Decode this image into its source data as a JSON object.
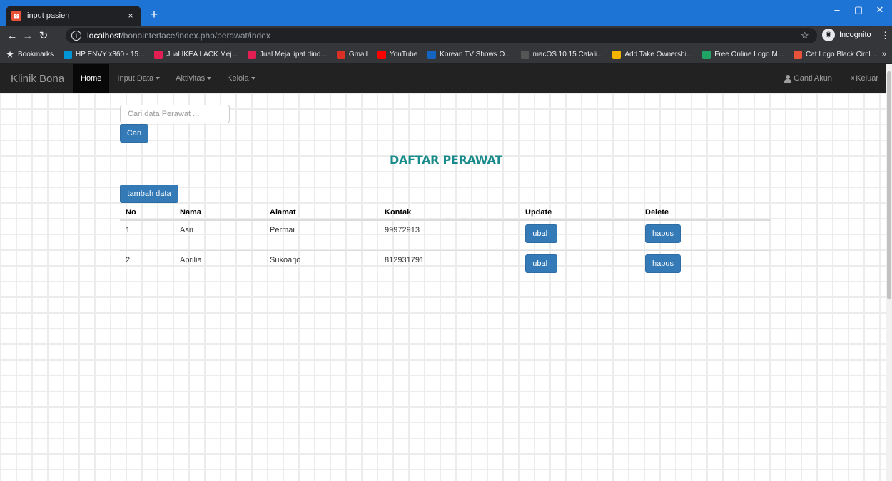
{
  "browser": {
    "tab_title": "input pasien",
    "tab_close": "×",
    "new_tab": "+",
    "win_min": "–",
    "win_max": "▢",
    "win_close": "✕",
    "url_host": "localhost",
    "url_path": "/bonainterface/index.php/perawat/index",
    "incognito_label": "Incognito",
    "bookmarks": [
      {
        "label": "Bookmarks",
        "color": "#35363a"
      },
      {
        "label": "HP ENVY x360 - 15...",
        "color": "#0096d6"
      },
      {
        "label": "Jual IKEA LACK Mej...",
        "color": "#e31e52"
      },
      {
        "label": "Jual Meja lipat dind...",
        "color": "#e31e52"
      },
      {
        "label": "Gmail",
        "color": "#d93025"
      },
      {
        "label": "YouTube",
        "color": "#ff0000"
      },
      {
        "label": "Korean TV Shows O...",
        "color": "#1565c0"
      },
      {
        "label": "macOS 10.15 Catali...",
        "color": "#555555"
      },
      {
        "label": "Add Take Ownershi...",
        "color": "#f4b400"
      },
      {
        "label": "Free Online Logo M...",
        "color": "#1fa463"
      },
      {
        "label": "Cat Logo Black Circl...",
        "color": "#e8513a"
      }
    ]
  },
  "navbar": {
    "brand": "Klinik Bona",
    "home": "Home",
    "input_data": "Input Data",
    "aktivitas": "Aktivitas",
    "kelola": "Kelola",
    "ganti_akun": "Ganti Akun",
    "keluar": "Keluar"
  },
  "search": {
    "placeholder": "Cari data Perawat ...",
    "button": "Cari"
  },
  "page": {
    "title": "DAFTAR PERAWAT",
    "add_button": "tambah data"
  },
  "table": {
    "headers": [
      "No",
      "Nama",
      "Alamat",
      "Kontak",
      "Update",
      "Delete"
    ],
    "rows": [
      {
        "no": "1",
        "nama": "Asri",
        "alamat": "Permai",
        "kontak": "99972913",
        "update": "ubah",
        "delete": "hapus"
      },
      {
        "no": "2",
        "nama": "Aprilia",
        "alamat": "Sukoarjo",
        "kontak": "812931791",
        "update": "ubah",
        "delete": "hapus"
      }
    ]
  },
  "colors": {
    "primary_button": "#337ab7",
    "heading": "#1a8b8b",
    "navbar_bg": "#222222",
    "chrome_accent": "#1e74d4"
  }
}
